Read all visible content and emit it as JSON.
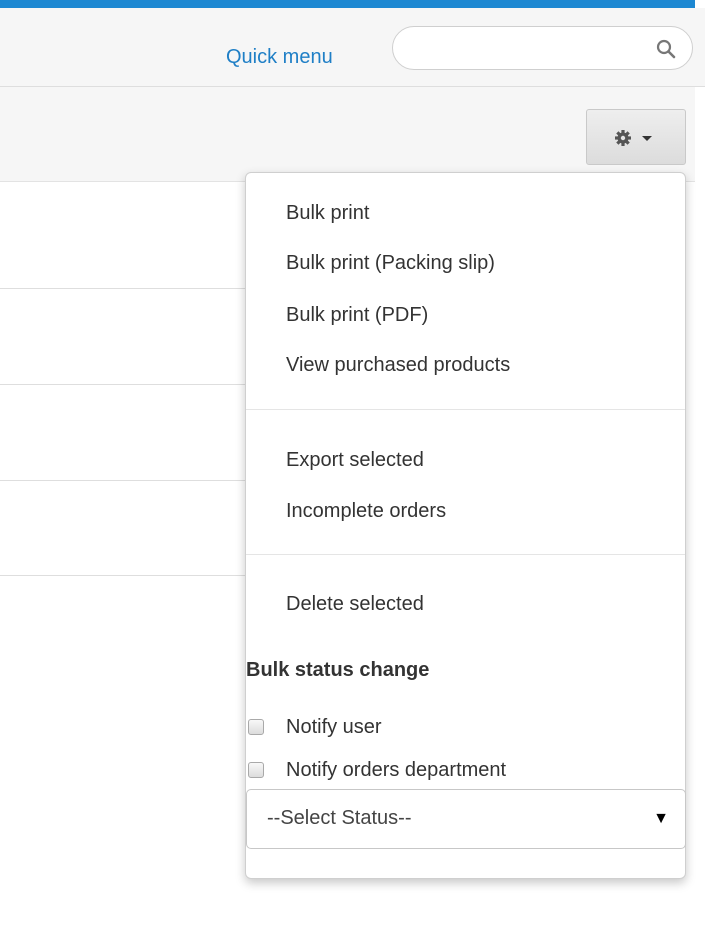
{
  "header": {
    "quick_menu": "Quick menu",
    "search": {
      "placeholder": "",
      "icon": "search-icon"
    }
  },
  "toolbar": {
    "settings_button": {
      "icon": "gear-icon",
      "caret_icon": "caret-down-icon"
    }
  },
  "menu": {
    "group1": [
      "Bulk print",
      "Bulk print (Packing slip)",
      "Bulk print (PDF)",
      "View purchased products"
    ],
    "group2": [
      "Export selected",
      "Incomplete orders"
    ],
    "group3": [
      "Delete selected"
    ],
    "bulk_status": {
      "title": "Bulk status change",
      "notify_user": "Notify user",
      "notify_orders_department": "Notify orders department",
      "select_value": "--Select Status--"
    }
  },
  "colors": {
    "accent": "#1d88d2",
    "link": "#1f7fc6"
  }
}
